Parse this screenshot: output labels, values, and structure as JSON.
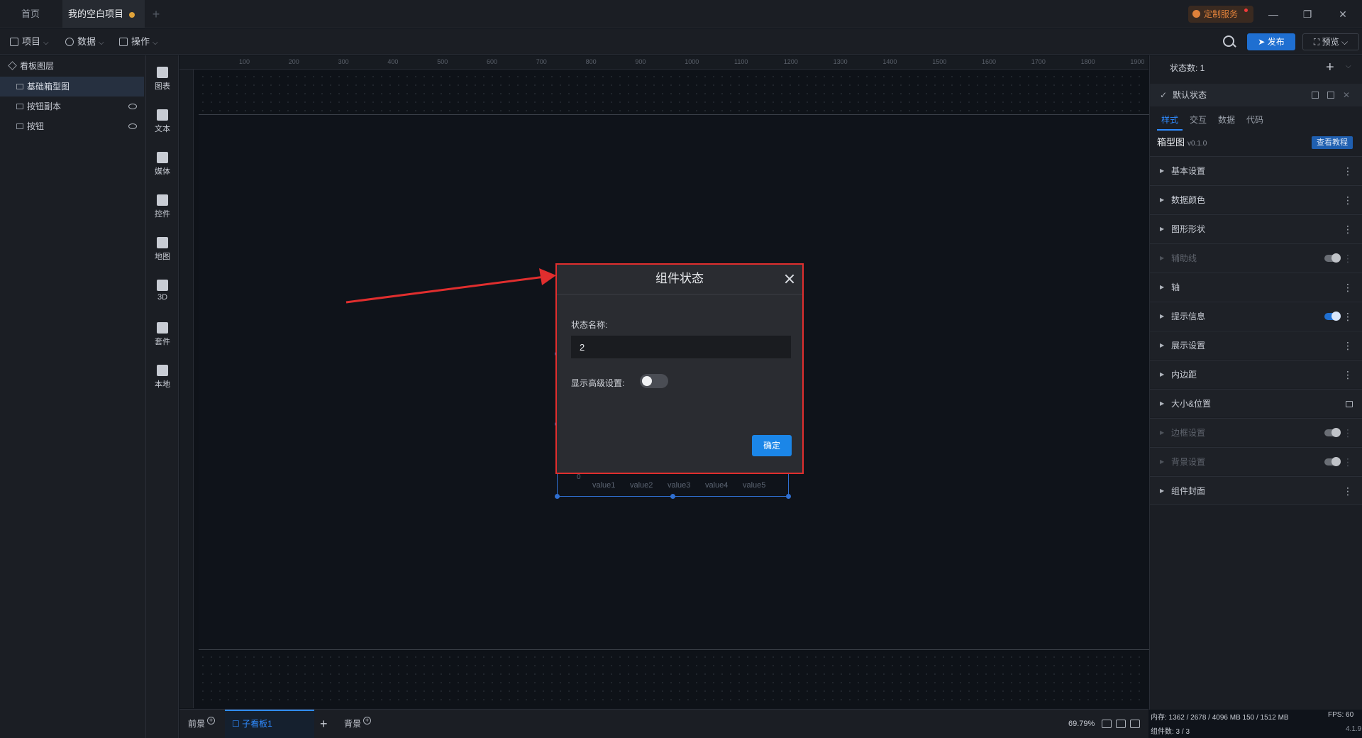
{
  "titlebar": {
    "tabs": [
      "首页",
      "我的空白项目"
    ],
    "custom_service": "定制服务"
  },
  "toolbar": {
    "menus": [
      "项目",
      "数据",
      "操作"
    ],
    "publish": "发布",
    "preview": "预览"
  },
  "layers": {
    "title": "看板图层",
    "items": [
      {
        "label": "基础箱型图"
      },
      {
        "label": "按钮副本"
      },
      {
        "label": "按钮"
      }
    ]
  },
  "categories": [
    "图表",
    "文本",
    "媒体",
    "控件",
    "地图",
    "3D",
    "套件",
    "本地"
  ],
  "ruler": {
    "top": [
      "100",
      "200",
      "300",
      "400",
      "500",
      "600",
      "700",
      "800",
      "900",
      "1000",
      "1100",
      "1200",
      "1300",
      "1400",
      "1500",
      "1600",
      "1700",
      "1800",
      "1900"
    ]
  },
  "chart": {
    "zero_label": "0",
    "x_labels": [
      "value1",
      "value2",
      "value3",
      "value4",
      "value5"
    ]
  },
  "dialog": {
    "title": "组件状态",
    "name_label": "状态名称:",
    "name_value": "2",
    "advanced_label": "显示高级设置:",
    "advanced_on": false,
    "confirm": "确定"
  },
  "bottom": {
    "foreground": "前景",
    "sub_board": "子看板1",
    "background": "背景",
    "zoom": "69.79%"
  },
  "right_panel": {
    "state_count": "状态数: 1",
    "default_state": "默认状态",
    "tabs": [
      "样式",
      "交互",
      "数据",
      "代码"
    ],
    "component_name": "箱型图",
    "version": "v0.1.0",
    "tutorial": "查看教程",
    "sections": [
      "基本设置",
      "数据颜色",
      "图形形状",
      "辅助线",
      "轴",
      "提示信息",
      "展示设置",
      "内边距",
      "大小&位置",
      "边框设置",
      "背景设置",
      "组件封面"
    ]
  },
  "status": {
    "memory": "内存: 1362 / 2678 / 4096 MB 150 / 1512 MB",
    "fps": "FPS: 60",
    "component_count": "组件数: 3 / 3",
    "version": "4.1.9"
  },
  "colors": {
    "accent": "#1f6fd1",
    "highlight_border": "#e02e2e",
    "confirm_button": "#1b86e8"
  }
}
